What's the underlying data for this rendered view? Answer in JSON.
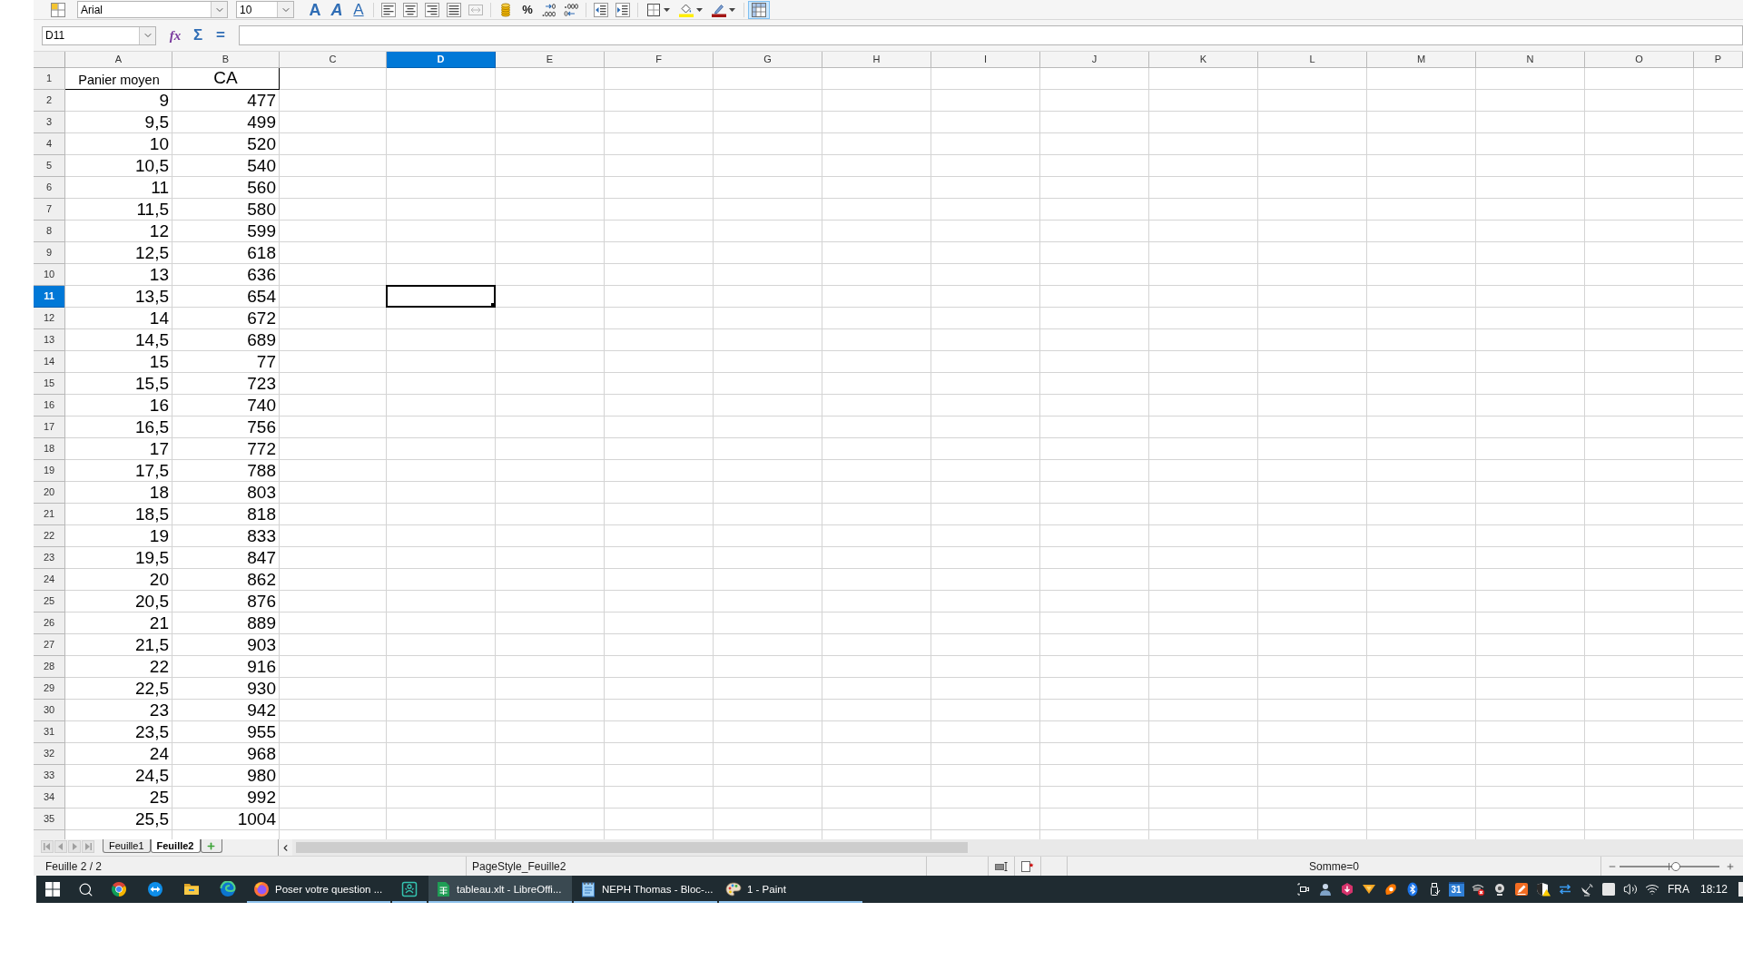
{
  "toolbar": {
    "font_name": "Arial",
    "font_size": "10",
    "groups": [
      [
        {
          "kind": "bold",
          "label": "A",
          "active": false,
          "disabled": false
        },
        {
          "kind": "italic",
          "label": "A",
          "active": false,
          "disabled": false
        },
        {
          "kind": "underline",
          "label": "A",
          "active": false,
          "disabled": false
        }
      ],
      [
        {
          "kind": "align-left",
          "active": false,
          "disabled": false
        },
        {
          "kind": "align-center",
          "active": false,
          "disabled": false
        },
        {
          "kind": "align-right",
          "active": false,
          "disabled": false
        },
        {
          "kind": "justify",
          "active": false,
          "disabled": false
        },
        {
          "kind": "merge",
          "active": false,
          "disabled": true
        }
      ],
      [
        {
          "kind": "currency",
          "active": false,
          "disabled": false
        },
        {
          "kind": "percent",
          "label": "%",
          "active": false,
          "disabled": false
        },
        {
          "kind": "add-decimal",
          "active": false,
          "disabled": false
        },
        {
          "kind": "delete-decimal",
          "active": false,
          "disabled": false
        }
      ],
      [
        {
          "kind": "indent-decrease",
          "active": false,
          "disabled": false
        },
        {
          "kind": "indent-increase",
          "active": false,
          "disabled": false
        }
      ],
      [
        {
          "kind": "borders",
          "active": false,
          "disabled": false
        },
        {
          "kind": "background-color",
          "active": false,
          "disabled": false
        },
        {
          "kind": "font-color",
          "active": false,
          "disabled": false
        }
      ],
      [
        {
          "kind": "freeze",
          "active": true,
          "disabled": false
        }
      ]
    ]
  },
  "formula_bar": {
    "name_box": "D11",
    "buttons": [
      {
        "kind": "function",
        "label": "fx"
      },
      {
        "kind": "sum",
        "label": "Σ"
      },
      {
        "kind": "formula",
        "label": "="
      }
    ]
  },
  "columns": [
    {
      "label": "A",
      "selected": false
    },
    {
      "label": "B",
      "selected": false
    },
    {
      "label": "C",
      "selected": false
    },
    {
      "label": "D",
      "selected": true
    },
    {
      "label": "E",
      "selected": false
    },
    {
      "label": "F",
      "selected": false
    },
    {
      "label": "G",
      "selected": false
    },
    {
      "label": "H",
      "selected": false
    },
    {
      "label": "I",
      "selected": false
    },
    {
      "label": "J",
      "selected": false
    },
    {
      "label": "K",
      "selected": false
    },
    {
      "label": "L",
      "selected": false
    },
    {
      "label": "M",
      "selected": false
    },
    {
      "label": "N",
      "selected": false
    },
    {
      "label": "O",
      "selected": false
    },
    {
      "label": "P",
      "selected": false
    }
  ],
  "rows": [
    {
      "label": "1",
      "kind": "header",
      "selected": false,
      "cells": [
        "Panier moyen",
        "CA"
      ]
    },
    {
      "label": "2",
      "kind": "data",
      "selected": false,
      "cells": [
        "9",
        "477"
      ]
    },
    {
      "label": "3",
      "kind": "data",
      "selected": false,
      "cells": [
        "9,5",
        "499"
      ]
    },
    {
      "label": "4",
      "kind": "data",
      "selected": false,
      "cells": [
        "10",
        "520"
      ]
    },
    {
      "label": "5",
      "kind": "data",
      "selected": false,
      "cells": [
        "10,5",
        "540"
      ]
    },
    {
      "label": "6",
      "kind": "data",
      "selected": false,
      "cells": [
        "11",
        "560"
      ]
    },
    {
      "label": "7",
      "kind": "data",
      "selected": false,
      "cells": [
        "11,5",
        "580"
      ]
    },
    {
      "label": "8",
      "kind": "data",
      "selected": false,
      "cells": [
        "12",
        "599"
      ]
    },
    {
      "label": "9",
      "kind": "data",
      "selected": false,
      "cells": [
        "12,5",
        "618"
      ]
    },
    {
      "label": "10",
      "kind": "data",
      "selected": false,
      "cells": [
        "13",
        "636"
      ]
    },
    {
      "label": "11",
      "kind": "data",
      "selected": true,
      "cells": [
        "13,5",
        "654"
      ]
    },
    {
      "label": "12",
      "kind": "data",
      "selected": false,
      "cells": [
        "14",
        "672"
      ]
    },
    {
      "label": "13",
      "kind": "data",
      "selected": false,
      "cells": [
        "14,5",
        "689"
      ]
    },
    {
      "label": "14",
      "kind": "data",
      "selected": false,
      "cells": [
        "15",
        "77"
      ]
    },
    {
      "label": "15",
      "kind": "data",
      "selected": false,
      "cells": [
        "15,5",
        "723"
      ]
    },
    {
      "label": "16",
      "kind": "data",
      "selected": false,
      "cells": [
        "16",
        "740"
      ]
    },
    {
      "label": "17",
      "kind": "data",
      "selected": false,
      "cells": [
        "16,5",
        "756"
      ]
    },
    {
      "label": "18",
      "kind": "data",
      "selected": false,
      "cells": [
        "17",
        "772"
      ]
    },
    {
      "label": "19",
      "kind": "data",
      "selected": false,
      "cells": [
        "17,5",
        "788"
      ]
    },
    {
      "label": "20",
      "kind": "data",
      "selected": false,
      "cells": [
        "18",
        "803"
      ]
    },
    {
      "label": "21",
      "kind": "data",
      "selected": false,
      "cells": [
        "18,5",
        "818"
      ]
    },
    {
      "label": "22",
      "kind": "data",
      "selected": false,
      "cells": [
        "19",
        "833"
      ]
    },
    {
      "label": "23",
      "kind": "data",
      "selected": false,
      "cells": [
        "19,5",
        "847"
      ]
    },
    {
      "label": "24",
      "kind": "data",
      "selected": false,
      "cells": [
        "20",
        "862"
      ]
    },
    {
      "label": "25",
      "kind": "data",
      "selected": false,
      "cells": [
        "20,5",
        "876"
      ]
    },
    {
      "label": "26",
      "kind": "data",
      "selected": false,
      "cells": [
        "21",
        "889"
      ]
    },
    {
      "label": "27",
      "kind": "data",
      "selected": false,
      "cells": [
        "21,5",
        "903"
      ]
    },
    {
      "label": "28",
      "kind": "data",
      "selected": false,
      "cells": [
        "22",
        "916"
      ]
    },
    {
      "label": "29",
      "kind": "data",
      "selected": false,
      "cells": [
        "22,5",
        "930"
      ]
    },
    {
      "label": "30",
      "kind": "data",
      "selected": false,
      "cells": [
        "23",
        "942"
      ]
    },
    {
      "label": "31",
      "kind": "data",
      "selected": false,
      "cells": [
        "23,5",
        "955"
      ]
    },
    {
      "label": "32",
      "kind": "data",
      "selected": false,
      "cells": [
        "24",
        "968"
      ]
    },
    {
      "label": "33",
      "kind": "data",
      "selected": false,
      "cells": [
        "24,5",
        "980"
      ]
    },
    {
      "label": "34",
      "kind": "data",
      "selected": false,
      "cells": [
        "25",
        "992"
      ]
    },
    {
      "label": "35",
      "kind": "data",
      "selected": false,
      "cells": [
        "25,5",
        "1004"
      ]
    }
  ],
  "sheet_tabs": [
    {
      "label": "Feuille1",
      "selected": false
    },
    {
      "label": "Feuille2",
      "selected": true
    }
  ],
  "status_bar": {
    "sheet": "Feuille 2 / 2",
    "page_style": "PageStyle_Feuille2",
    "sum": "Somme=0",
    "zoom": {
      "level": 0.56
    }
  },
  "taskbar": {
    "apps": [
      {
        "kind": "ring",
        "running": false,
        "selected": false
      },
      {
        "kind": "arrows-circle",
        "running": false,
        "selected": false
      },
      {
        "kind": "folder",
        "running": false,
        "selected": false
      },
      {
        "kind": "swirl",
        "running": false,
        "selected": false
      },
      {
        "kind": "disc",
        "label": "Poser votre question ...",
        "running": true,
        "selected": false
      },
      {
        "kind": "boxed-figure",
        "running": true,
        "selected": false
      },
      {
        "kind": "spreadsheet",
        "label": "tableau.xlt - LibreOffi...",
        "running": true,
        "selected": true
      },
      {
        "kind": "notepad",
        "label": "NEPH Thomas - Bloc-...",
        "running": true,
        "selected": false
      },
      {
        "kind": "palette",
        "label": "1 - Paint",
        "running": true,
        "selected": false
      }
    ],
    "tray": [
      {
        "kind": "camera"
      },
      {
        "kind": "person"
      },
      {
        "kind": "download"
      },
      {
        "kind": "wedge"
      },
      {
        "kind": "splash"
      },
      {
        "kind": "bluetooth"
      },
      {
        "kind": "usb"
      },
      {
        "kind": "calendar",
        "label": "31"
      },
      {
        "kind": "network-error"
      },
      {
        "kind": "webcam"
      },
      {
        "kind": "pen-square"
      },
      {
        "kind": "shield"
      },
      {
        "kind": "sync"
      },
      {
        "kind": "dish"
      },
      {
        "kind": "square"
      },
      {
        "kind": "volume"
      },
      {
        "kind": "wifi"
      }
    ],
    "language": "FRA",
    "time": "18:12"
  }
}
